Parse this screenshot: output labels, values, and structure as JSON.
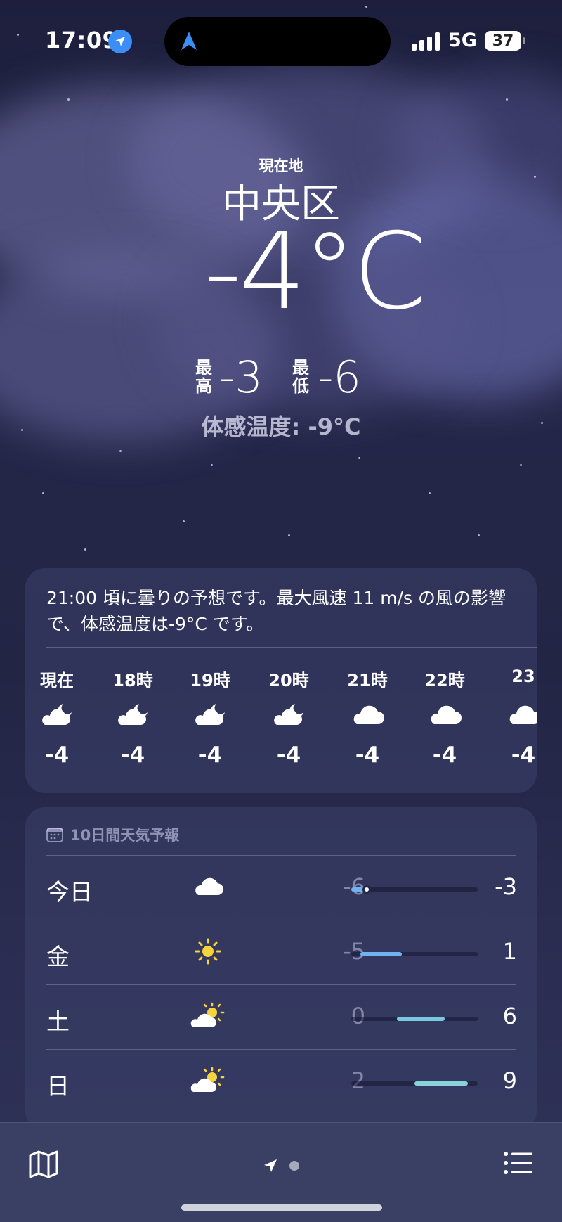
{
  "status_bar": {
    "time": "17:09",
    "network": "5G",
    "battery": "37",
    "location_icon": "location-arrow-icon"
  },
  "hero": {
    "location_label": "現在地",
    "city": "中央区",
    "temperature": "-4°C",
    "high_label": "最高",
    "high": "-3",
    "low_label": "最低",
    "low": "-6",
    "feels_like": "体感温度: -9°C"
  },
  "hourly": {
    "summary": "21:00 頃に曇りの予想です。最大風速 11 m/s の風の影響で、体感温度は-9°C です。",
    "items": [
      {
        "label": "現在",
        "icon": "cloud-moon-icon",
        "temp": "-4"
      },
      {
        "label": "18時",
        "icon": "cloud-moon-icon",
        "temp": "-4"
      },
      {
        "label": "19時",
        "icon": "cloud-moon-icon",
        "temp": "-4"
      },
      {
        "label": "20時",
        "icon": "cloud-moon-icon",
        "temp": "-4"
      },
      {
        "label": "21時",
        "icon": "cloud-icon",
        "temp": "-4"
      },
      {
        "label": "22時",
        "icon": "cloud-icon",
        "temp": "-4"
      },
      {
        "label": "23",
        "icon": "cloud-icon",
        "temp": "-4"
      }
    ]
  },
  "daily": {
    "header": "10日間天気予報",
    "header_icon": "calendar-icon",
    "days": [
      {
        "name": "今日",
        "icon": "cloud-icon",
        "low": "-6",
        "high": "-3",
        "bar_start": 0.0,
        "bar_end": 0.12,
        "color": "#6fb3ef"
      },
      {
        "name": "金",
        "icon": "sun-icon",
        "low": "-5",
        "high": "1",
        "bar_start": 0.07,
        "bar_end": 0.4,
        "color": "#6fb3ef"
      },
      {
        "name": "土",
        "icon": "cloud-sun-icon",
        "low": "0",
        "high": "6",
        "bar_start": 0.36,
        "bar_end": 0.74,
        "color": "#7cc8e0"
      },
      {
        "name": "日",
        "icon": "cloud-sun-icon",
        "low": "2",
        "high": "9",
        "bar_start": 0.5,
        "bar_end": 0.92,
        "color": "#86d3da"
      }
    ]
  },
  "tab_bar": {
    "map_icon": "map-icon",
    "location_icon": "location-arrow-icon",
    "page_dot_icon": "page-dot-icon",
    "list_icon": "list-icon"
  },
  "colors": {
    "card_bg": "#3c416c",
    "accent_blue": "#3b8ef5"
  }
}
